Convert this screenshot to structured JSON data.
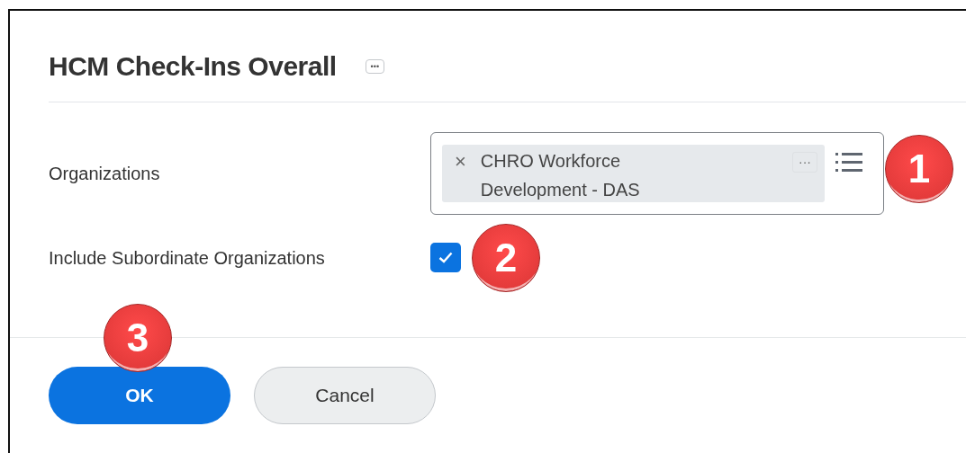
{
  "title": "HCM Check-Ins Overall",
  "title_menu": {
    "label": "•••"
  },
  "fields": [
    {
      "kind": "multiselect",
      "label": "Organizations",
      "tags": [
        {
          "remove": "×",
          "text": "CHRO Workforce Development - DAS",
          "menu": "···"
        }
      ],
      "callout": "1"
    },
    {
      "kind": "checkbox",
      "label": "Include Subordinate Organizations",
      "checked": true,
      "callout": "2"
    }
  ],
  "buttons": [
    {
      "label": "OK",
      "kind": "primary",
      "callout": "3"
    },
    {
      "label": "Cancel",
      "kind": "secondary"
    }
  ]
}
